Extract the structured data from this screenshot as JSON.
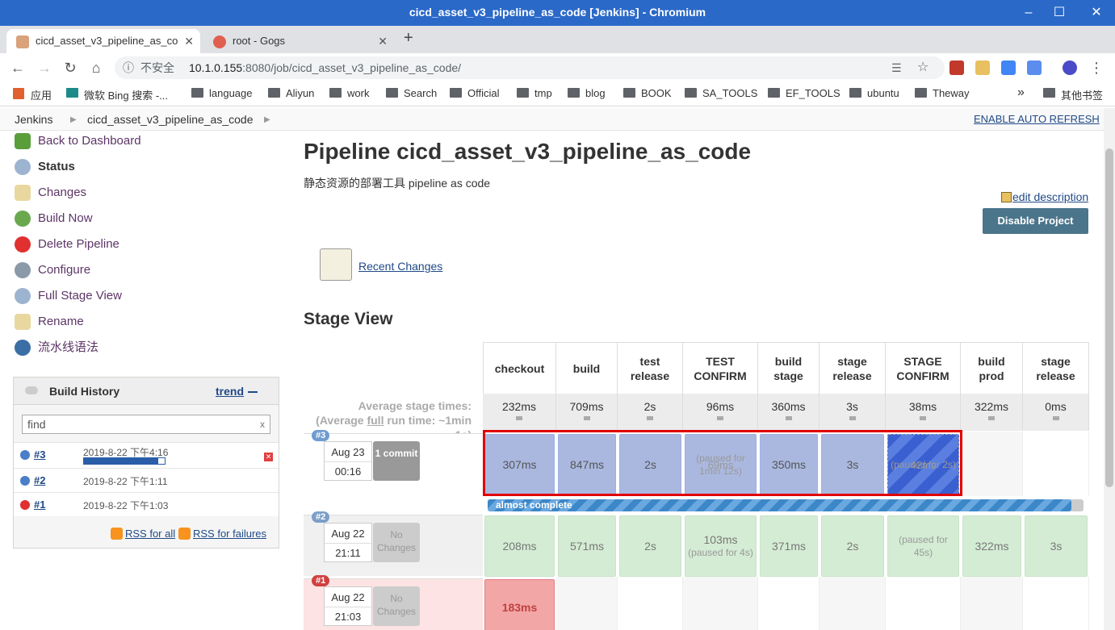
{
  "window": {
    "title": "cicd_asset_v3_pipeline_as_code [Jenkins] - Chromium"
  },
  "tabs": [
    {
      "label": "cicd_asset_v3_pipeline_as_co",
      "active": true
    },
    {
      "label": "root - Gogs",
      "active": false
    }
  ],
  "address": {
    "security": "不安全",
    "host": "10.1.0.155",
    "path": ":8080/job/cicd_asset_v3_pipeline_as_code/"
  },
  "bookmarks": {
    "apps": "应用",
    "bing": "微软 Bing 搜索 -...",
    "folders": [
      "language",
      "Aliyun",
      "work",
      "Search",
      "Official",
      "tmp",
      "blog",
      "BOOK",
      "SA_TOOLS",
      "EF_TOOLS",
      "ubuntu",
      "Theway"
    ],
    "other": "其他书签"
  },
  "breadcrumb": {
    "root": "Jenkins",
    "job": "cicd_asset_v3_pipeline_as_code",
    "auto_refresh": "ENABLE AUTO REFRESH"
  },
  "sidebar": {
    "tasks": [
      "Back to Dashboard",
      "Status",
      "Changes",
      "Build Now",
      "Delete Pipeline",
      "Configure",
      "Full Stage View",
      "Rename",
      "流水线语法"
    ]
  },
  "build_history": {
    "title": "Build History",
    "trend": "trend",
    "find": "find",
    "builds": [
      {
        "num": "#3",
        "date": "2019-8-22 下午4:16",
        "status": "running"
      },
      {
        "num": "#2",
        "date": "2019-8-22 下午1:11",
        "status": "success"
      },
      {
        "num": "#1",
        "date": "2019-8-22 下午1:03",
        "status": "failed"
      }
    ],
    "rss_all": "RSS for all",
    "rss_failures": "RSS for failures",
    "running_progress": 0.92
  },
  "page": {
    "title": "Pipeline cicd_asset_v3_pipeline_as_code",
    "description": "静态资源的部署工具 pipeline as code",
    "edit_description": "edit description",
    "disable": "Disable Project",
    "recent_changes": "Recent Changes",
    "stage_view": "Stage View"
  },
  "stage_view": {
    "avg_label": "Average stage times:",
    "avg_full_label_pre": "(Average ",
    "avg_full_label_link": "full",
    "avg_full_label_post": " run time: ~1min 1s)",
    "stages": [
      "checkout",
      "build",
      "test release",
      "TEST CONFIRM",
      "build stage",
      "stage release",
      "STAGE CONFIRM",
      "build prod",
      "stage release"
    ],
    "averages": [
      "232ms",
      "709ms",
      "2s",
      "96ms",
      "360ms",
      "3s",
      "38ms",
      "322ms",
      "0ms"
    ],
    "runs": [
      {
        "badge": "#3",
        "date": "Aug 23",
        "time": "00:16",
        "changes": "1 commit",
        "cells": [
          "307ms",
          "847ms",
          "2s",
          "69ms",
          "350ms",
          "3s",
          "42ms",
          "",
          ""
        ],
        "pauses": [
          "",
          "",
          "",
          "(paused for 1min 12s)",
          "",
          "",
          "(paused for 2s)",
          "",
          ""
        ],
        "progress_label": "almost complete",
        "progress": 0.98
      },
      {
        "badge": "#2",
        "date": "Aug 22",
        "time": "21:11",
        "changes": "No Changes",
        "cells": [
          "208ms",
          "571ms",
          "2s",
          "103ms",
          "371ms",
          "2s",
          "",
          "322ms",
          "3s"
        ],
        "pauses": [
          "",
          "",
          "",
          "(paused for 4s)",
          "",
          "",
          "(paused for 45s)",
          "",
          ""
        ]
      },
      {
        "badge": "#1",
        "date": "Aug 22",
        "time": "21:03",
        "changes": "No Changes",
        "cells": [
          "183ms",
          "",
          "",
          "",
          "",
          "",
          "",
          "",
          ""
        ]
      }
    ]
  },
  "colors": {
    "jenkins_link": "#204a87",
    "titlebar": "#2a69c8",
    "highlight": "#e00000"
  }
}
